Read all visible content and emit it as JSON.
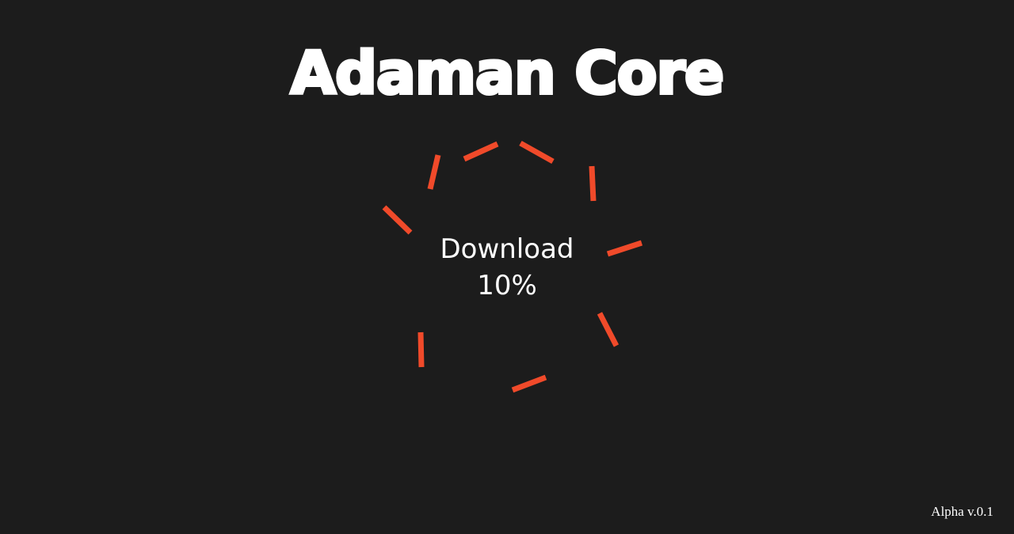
{
  "app": {
    "title": "Adaman Core"
  },
  "loader": {
    "status_label": "Download",
    "progress_text": "10%",
    "progress": 0.1,
    "icon": "spinner-dashed-ring-icon",
    "accent_color": "#f04a2a"
  },
  "footer": {
    "version": "Alpha v.0.1"
  },
  "colors": {
    "background": "#1c1c1c",
    "text": "#ffffff",
    "accent": "#f04a2a"
  }
}
